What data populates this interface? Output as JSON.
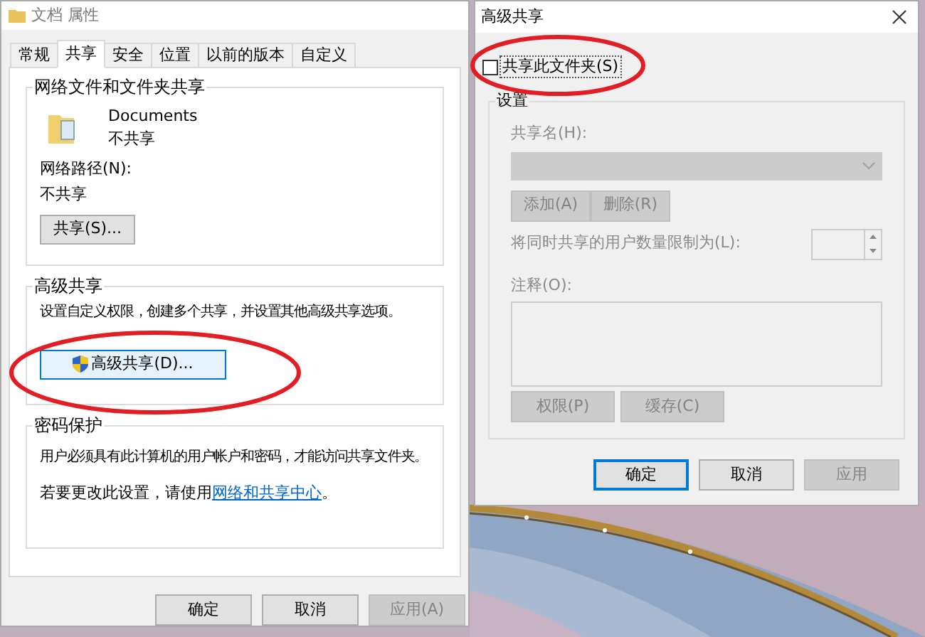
{
  "main_window": {
    "title": "文档 属性",
    "tabs": [
      {
        "label": "常规",
        "selected": false
      },
      {
        "label": "共享",
        "selected": true
      },
      {
        "label": "安全",
        "selected": false
      },
      {
        "label": "位置",
        "selected": false
      },
      {
        "label": "以前的版本",
        "selected": false
      },
      {
        "label": "自定义",
        "selected": false
      }
    ],
    "network_sharing": {
      "heading": "网络文件和文件夹共享",
      "folder_name": "Documents",
      "folder_status": "不共享",
      "path_label": "网络路径(N):",
      "path_value": "不共享",
      "share_button": "共享(S)..."
    },
    "advanced_sharing": {
      "heading": "高级共享",
      "description": "设置自定义权限，创建多个共享，并设置其他高级共享选项。",
      "button": "高级共享(D)..."
    },
    "password_protection": {
      "heading": "密码保护",
      "text": "用户必须具有此计算机的用户帐户和密码，才能访问共享文件夹。",
      "link_prefix": "若要更改此设置，请使用",
      "link": "网络和共享中心",
      "link_suffix": "。"
    },
    "buttons": [
      {
        "label": "确定",
        "disabled": false
      },
      {
        "label": "取消",
        "disabled": false
      },
      {
        "label": "应用(A)",
        "disabled": true
      }
    ]
  },
  "dialog": {
    "title": "高级共享",
    "share_checkbox": {
      "label": "共享此文件夹(S)",
      "checked": false
    },
    "settings": {
      "heading": "设置",
      "disabled": true,
      "share_name_label": "共享名(H):",
      "add_button": "添加(A)",
      "remove_button": "删除(R)",
      "limit_label": "将同时共享的用户数量限制为(L):",
      "comment_label": "注释(O):",
      "permissions_button": "权限(P)",
      "caching_button": "缓存(C)"
    },
    "buttons": [
      {
        "label": "确定",
        "disabled": false,
        "focused": true
      },
      {
        "label": "取消",
        "disabled": false,
        "focused": false
      },
      {
        "label": "应用",
        "disabled": true,
        "focused": false
      }
    ]
  }
}
